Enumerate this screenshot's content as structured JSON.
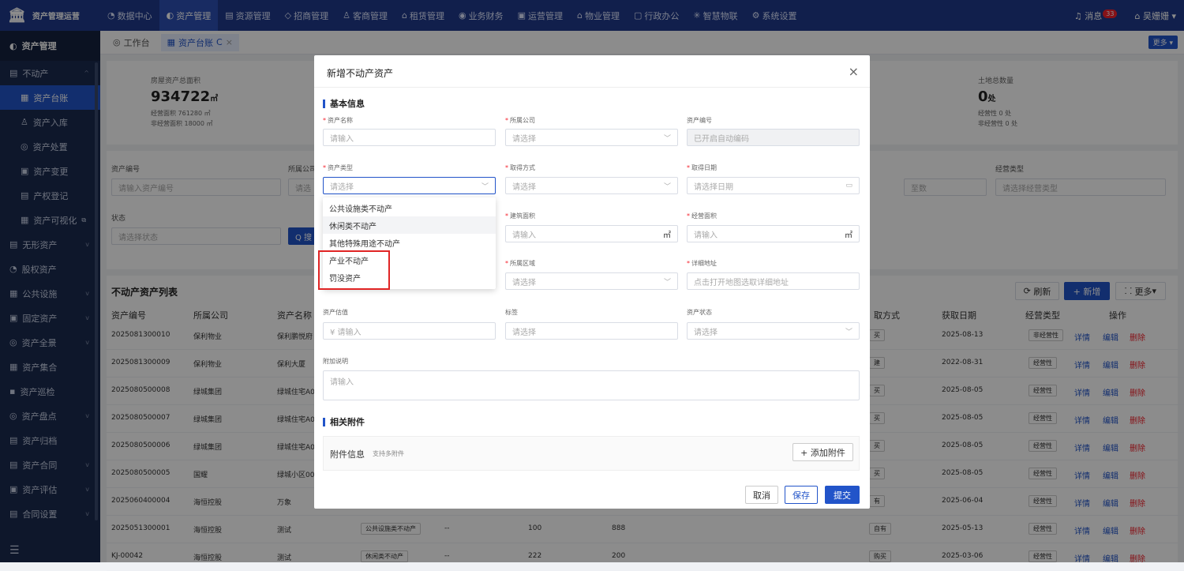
{
  "app": {
    "title": "资产管理运营"
  },
  "nav": [
    {
      "icon": "◔",
      "label": "数据中心"
    },
    {
      "icon": "◐",
      "label": "资产管理",
      "active": true
    },
    {
      "icon": "▤",
      "label": "资源管理"
    },
    {
      "icon": "◇",
      "label": "招商管理"
    },
    {
      "icon": "♙",
      "label": "客商管理"
    },
    {
      "icon": "⌂",
      "label": "租赁管理"
    },
    {
      "icon": "◉",
      "label": "业务财务"
    },
    {
      "icon": "▣",
      "label": "运营管理"
    },
    {
      "icon": "⌂",
      "label": "物业管理"
    },
    {
      "icon": "▢",
      "label": "行政办公"
    },
    {
      "icon": "✳",
      "label": "智慧物联"
    },
    {
      "icon": "⚙",
      "label": "系统设置"
    }
  ],
  "topright": {
    "messages_label": "消息",
    "messages_count": "33",
    "user": "吴姗姗"
  },
  "sidebar": {
    "header": "资产管理",
    "items": [
      {
        "label": "不动产",
        "sub": false,
        "icon": "▤",
        "arrow": "^"
      },
      {
        "label": "资产台账",
        "sub": true,
        "icon": "▦",
        "active": true
      },
      {
        "label": "资产入库",
        "sub": true,
        "icon": "♙"
      },
      {
        "label": "资产处置",
        "sub": true,
        "icon": "◎"
      },
      {
        "label": "资产变更",
        "sub": true,
        "icon": "▣"
      },
      {
        "label": "产权登记",
        "sub": true,
        "icon": "▤"
      },
      {
        "label": "资产可视化",
        "sub": true,
        "icon": "▦",
        "ext": "⧉"
      },
      {
        "label": "无形资产",
        "sub": false,
        "icon": "▤",
        "arrow": "v"
      },
      {
        "label": "股权资产",
        "sub": false,
        "icon": "◔"
      },
      {
        "label": "公共设施",
        "sub": false,
        "icon": "▦",
        "arrow": "v"
      },
      {
        "label": "固定资产",
        "sub": false,
        "icon": "▣",
        "arrow": "v"
      },
      {
        "label": "资产全景",
        "sub": false,
        "icon": "◎",
        "arrow": "v"
      },
      {
        "label": "资产集合",
        "sub": false,
        "icon": "▦"
      },
      {
        "label": "资产巡检",
        "sub": false,
        "icon": "▪"
      },
      {
        "label": "资产盘点",
        "sub": false,
        "icon": "◎",
        "arrow": "v"
      },
      {
        "label": "资产归档",
        "sub": false,
        "icon": "▤"
      },
      {
        "label": "资产合同",
        "sub": false,
        "icon": "▤",
        "arrow": "v"
      },
      {
        "label": "资产评估",
        "sub": false,
        "icon": "▣",
        "arrow": "v"
      },
      {
        "label": "合同设置",
        "sub": false,
        "icon": "▤",
        "arrow": "v"
      }
    ],
    "footer_icon": "☰"
  },
  "tabs": [
    {
      "icon": "◎",
      "label": "工作台"
    },
    {
      "icon": "▦",
      "label": "资产台账",
      "active": true,
      "refresh": "C",
      "close": "×"
    }
  ],
  "more_label": "更多 ▾",
  "stats": {
    "left": {
      "label": "房屋资产总面积",
      "value": "934722",
      "unit": "㎡",
      "line1": "经营面积 761280 ㎡",
      "line2": "非经营面积 18000 ㎡"
    },
    "right": {
      "label": "土地总数量",
      "value": "0",
      "unit": "处",
      "line1": "经营性 0 处",
      "line2": "非经营性 0 处"
    }
  },
  "filters": {
    "code_label": "资产编号",
    "code_ph": "请输入资产编号",
    "company_label": "所属公司",
    "company_ph": "请选",
    "status_label": "状态",
    "status_ph": "请选择状态",
    "search_btn": "Q 搜",
    "range_to": "至数",
    "optype_label": "经营类型",
    "optype_ph": "请选择经营类型"
  },
  "table": {
    "title": "不动产资产列表",
    "refresh": "刷新",
    "add": "+ 新增",
    "more": "更多",
    "headers": [
      "资产编号",
      "所属公司",
      "资产名称",
      "取方式",
      "获取日期",
      "经营类型",
      "操作"
    ],
    "ops": [
      "详情",
      "编辑",
      "删除"
    ],
    "rows": [
      {
        "code": "2025081300010",
        "company": "保利物业",
        "name": "保利鹏悦府",
        "method": "买",
        "date": "2025-08-13",
        "type": "非经营性"
      },
      {
        "code": "2025081300009",
        "company": "保利物业",
        "name": "保利大厦",
        "method": "建",
        "date": "2022-08-31",
        "type": "经营性"
      },
      {
        "code": "2025080500008",
        "company": "绿城集团",
        "name": "绿城住宅A00",
        "method": "买",
        "date": "2025-08-05",
        "type": "经营性"
      },
      {
        "code": "2025080500007",
        "company": "绿城集团",
        "name": "绿城住宅A02",
        "method": "买",
        "date": "2025-08-05",
        "type": "经营性"
      },
      {
        "code": "2025080500006",
        "company": "绿城集团",
        "name": "绿城住宅A01",
        "method": "买",
        "date": "2025-08-05",
        "type": "经营性"
      },
      {
        "code": "2025080500005",
        "company": "国耀",
        "name": "绿城小区001",
        "method": "买",
        "date": "2025-08-05",
        "type": "经营性"
      },
      {
        "code": "2025060400004",
        "company": "海恒控股",
        "name": "万象",
        "method": "有",
        "date": "2025-06-04",
        "type": "经营性"
      },
      {
        "code": "2025051300001",
        "company": "海恒控股",
        "name": "测试",
        "assettype": "公共设施类不动产",
        "dash": "--",
        "area": "100",
        "oparea": "888",
        "method": "自有",
        "date": "2025-05-13",
        "type": "经营性"
      },
      {
        "code": "KJ-00042",
        "company": "海恒控股",
        "name": "测试",
        "assettype": "休闲类不动产",
        "dash": "--",
        "area": "222",
        "oparea": "200",
        "method": "购买",
        "date": "2025-03-06",
        "type": "经营性"
      }
    ]
  },
  "modal": {
    "title": "新增不动产资产",
    "close": "×",
    "sec_basic": "基本信息",
    "sec_attach": "相关附件",
    "name_label": "资产名称",
    "name_ph": "请输入",
    "company_label": "所属公司",
    "company_ph": "请选择",
    "code_label": "资产编号",
    "code_ph": "已开启自动编码",
    "type_label": "资产类型",
    "type_ph": "请选择",
    "method_label": "取得方式",
    "method_ph": "请选择",
    "date_label": "取得日期",
    "date_ph": "请选择日期",
    "barea_label": "建筑面积",
    "barea_ph": "请输入",
    "unit": "㎡",
    "oparea_label": "经营面积",
    "oparea_ph": "请输入",
    "region_label": "所属区域",
    "region_ph": "请选择",
    "addr_label": "详细地址",
    "addr_ph": "点击打开地图选取详细地址",
    "value_label": "资产估值",
    "value_ph": "¥ 请输入",
    "tag_label": "标签",
    "tag_ph": "请选择",
    "status_label": "资产状态",
    "status_ph": "请选择",
    "note_label": "附加说明",
    "note_ph": "请输入",
    "attach_label": "附件信息",
    "attach_hint": "支持多附件",
    "attach_btn": "+ 添加附件",
    "cancel": "取消",
    "save": "保存",
    "submit": "提交",
    "options": [
      "公共设施类不动产",
      "休闲类不动产",
      "其他特殊用途不动产",
      "产业不动产",
      "罚没资产"
    ]
  }
}
